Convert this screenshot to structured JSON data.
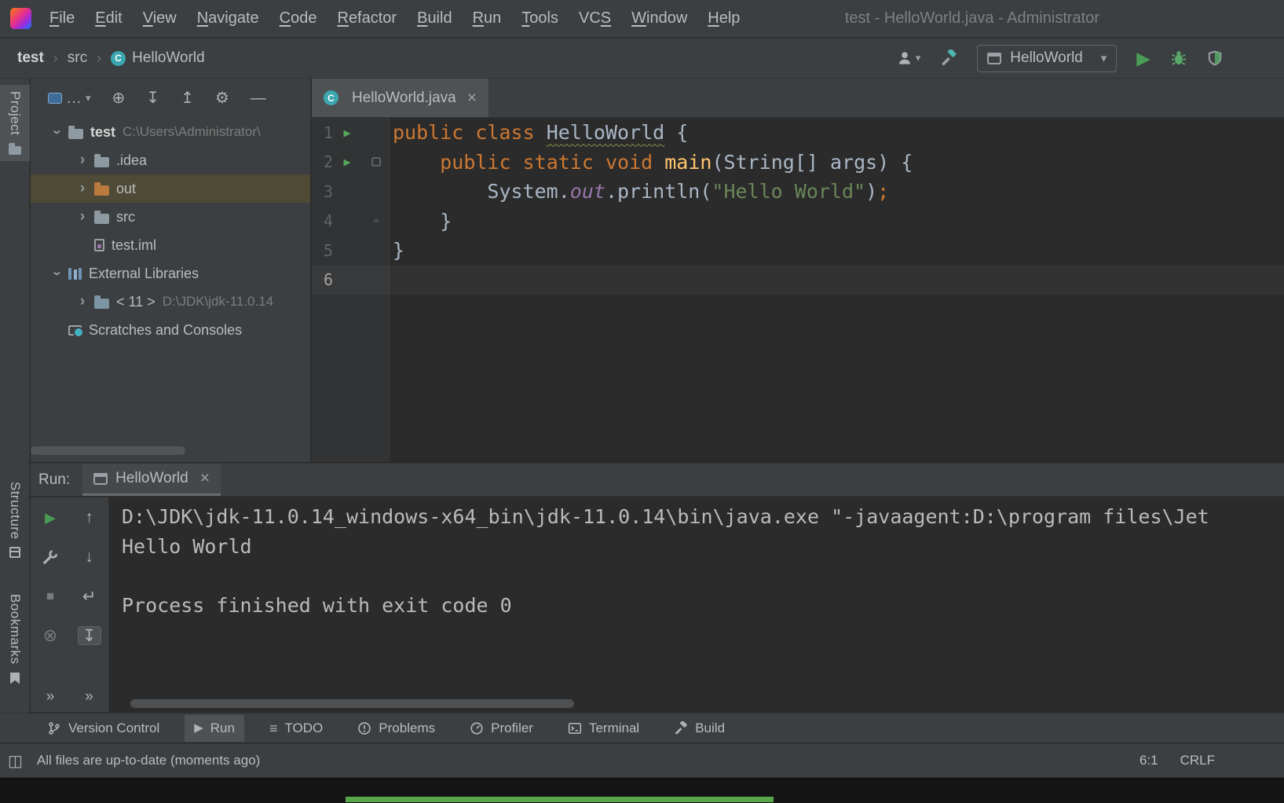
{
  "window": {
    "title": "test - HelloWorld.java - Administrator"
  },
  "menubar": {
    "items": [
      {
        "label": "File",
        "u": 0
      },
      {
        "label": "Edit",
        "u": 0
      },
      {
        "label": "View",
        "u": 0
      },
      {
        "label": "Navigate",
        "u": 0
      },
      {
        "label": "Code",
        "u": 0
      },
      {
        "label": "Refactor",
        "u": 0
      },
      {
        "label": "Build",
        "u": 0
      },
      {
        "label": "Run",
        "u": 0
      },
      {
        "label": "Tools",
        "u": 0
      },
      {
        "label": "VCS",
        "u": 2
      },
      {
        "label": "Window",
        "u": 0
      },
      {
        "label": "Help",
        "u": 0
      }
    ]
  },
  "breadcrumbs": {
    "separator": "›",
    "items": [
      {
        "label": "test",
        "bold": true
      },
      {
        "label": "src"
      },
      {
        "label": "HelloWorld",
        "icon": "class"
      }
    ]
  },
  "toolbar": {
    "run_config": "HelloWorld",
    "class_letter": "C"
  },
  "stripe": {
    "project": "Project",
    "structure": "Structure",
    "bookmarks": "Bookmarks"
  },
  "project_panel": {
    "tree": [
      {
        "indent": 0,
        "chevron": "expanded",
        "icon": "folder",
        "label": "test",
        "suffix": "C:\\Users\\Administrator\\",
        "bold": true
      },
      {
        "indent": 1,
        "chevron": "collapsed",
        "icon": "folder",
        "label": ".idea"
      },
      {
        "indent": 1,
        "chevron": "collapsed",
        "icon": "folder-excluded",
        "label": "out",
        "selected": true
      },
      {
        "indent": 1,
        "chevron": "collapsed",
        "icon": "folder",
        "label": "src"
      },
      {
        "indent": 1,
        "chevron": "none",
        "icon": "file-module",
        "label": "test.iml"
      },
      {
        "indent": 0,
        "chevron": "expanded",
        "icon": "libraries",
        "label": "External Libraries"
      },
      {
        "indent": 1,
        "chevron": "collapsed",
        "icon": "jdk",
        "label": "< 11 >",
        "suffix": "D:\\JDK\\jdk-11.0.14"
      },
      {
        "indent": 0,
        "chevron": "none",
        "icon": "scratches",
        "label": "Scratches and Consoles"
      }
    ]
  },
  "editor": {
    "tab": {
      "label": "HelloWorld.java"
    },
    "lines": [
      {
        "n": "1",
        "run": true,
        "fold": "",
        "tokens": [
          {
            "t": "public",
            "c": "kw"
          },
          {
            "t": " ",
            "c": "p"
          },
          {
            "t": "class",
            "c": "kw"
          },
          {
            "t": " ",
            "c": "p"
          },
          {
            "t": "HelloWorld",
            "c": "cls"
          },
          {
            "t": " {",
            "c": "p"
          }
        ]
      },
      {
        "n": "2",
        "run": true,
        "fold": "start",
        "tokens": [
          {
            "t": "    ",
            "c": "p"
          },
          {
            "t": "public",
            "c": "kw"
          },
          {
            "t": " ",
            "c": "p"
          },
          {
            "t": "static",
            "c": "kw"
          },
          {
            "t": " ",
            "c": "p"
          },
          {
            "t": "void",
            "c": "kw"
          },
          {
            "t": " ",
            "c": "p"
          },
          {
            "t": "main",
            "c": "m"
          },
          {
            "t": "(String[] args) {",
            "c": "p"
          }
        ]
      },
      {
        "n": "3",
        "run": false,
        "fold": "",
        "tokens": [
          {
            "t": "        System.",
            "c": "p"
          },
          {
            "t": "out",
            "c": "f"
          },
          {
            "t": ".println(",
            "c": "p"
          },
          {
            "t": "\"Hello World\"",
            "c": "s"
          },
          {
            "t": ")",
            "c": "p"
          },
          {
            "t": ";",
            "c": "kw"
          }
        ]
      },
      {
        "n": "4",
        "run": false,
        "fold": "end",
        "tokens": [
          {
            "t": "    }",
            "c": "p"
          }
        ]
      },
      {
        "n": "5",
        "run": false,
        "fold": "",
        "tokens": [
          {
            "t": "}",
            "c": "p"
          }
        ]
      },
      {
        "n": "6",
        "run": false,
        "fold": "",
        "active": true,
        "tokens": []
      }
    ]
  },
  "run_panel": {
    "label": "Run:",
    "tab": "HelloWorld",
    "console": [
      "D:\\JDK\\jdk-11.0.14_windows-x64_bin\\jdk-11.0.14\\bin\\java.exe \"-javaagent:D:\\program files\\Jet",
      "Hello World",
      "",
      "Process finished with exit code 0"
    ]
  },
  "bottom_bar": {
    "items": [
      {
        "label": "Version Control",
        "icon": "branch"
      },
      {
        "label": "Run",
        "icon": "run",
        "active": true
      },
      {
        "label": "TODO",
        "icon": "todo"
      },
      {
        "label": "Problems",
        "icon": "problems"
      },
      {
        "label": "Profiler",
        "icon": "profiler"
      },
      {
        "label": "Terminal",
        "icon": "terminal"
      },
      {
        "label": "Build",
        "icon": "hammer"
      }
    ]
  },
  "status_bar": {
    "message": "All files are up-to-date (moments ago)",
    "caret": "6:1",
    "line_ending": "CRLF"
  },
  "icons": {
    "dropdown": "▾",
    "more": "…",
    "chevron": "›",
    "target": "⊕",
    "expand_all": "↧",
    "collapse_all": "↥",
    "gear": "⚙",
    "hide": "—",
    "close": "×",
    "run": "▶",
    "stop": "■",
    "kill": "⊗",
    "up": "↑",
    "down": "↓",
    "soft_wrap": "↵",
    "scroll_end": "↧",
    "more_actions": "»",
    "todo": "≡",
    "layout": "◫"
  },
  "colors": {
    "run_green": "#499C54",
    "keyword_orange": "#CC7832",
    "string_green": "#6A8759",
    "selection_olive": "#4E4A35",
    "panel_bg": "#3C3F41",
    "editor_bg": "#2B2B2B"
  }
}
